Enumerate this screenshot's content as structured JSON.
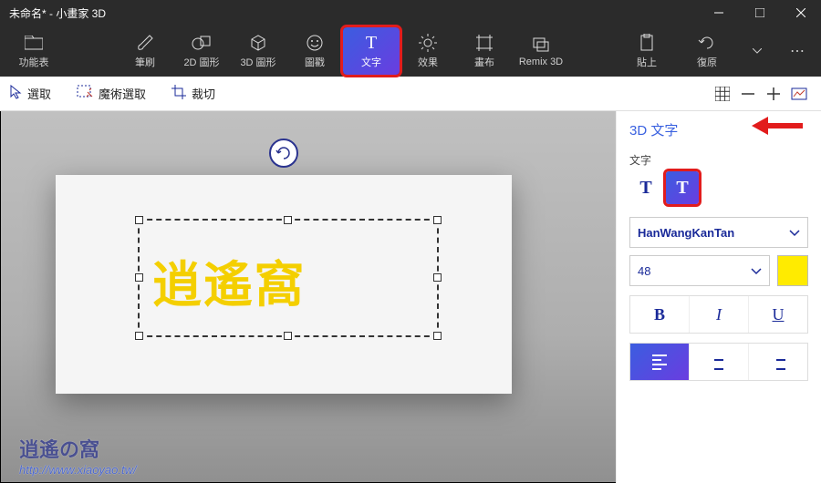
{
  "window": {
    "title": "未命名* - 小畫家 3D"
  },
  "ribbon": {
    "menu": "功能表",
    "brush": "筆刷",
    "shapes2d": "2D 圖形",
    "shapes3d": "3D 圖形",
    "stickers": "圖戳",
    "text": "文字",
    "effects": "效果",
    "canvas": "畫布",
    "remix": "Remix 3D",
    "paste": "貼上",
    "undo": "復原"
  },
  "subbar": {
    "select": "選取",
    "magic": "魔術選取",
    "crop": "裁切"
  },
  "panel": {
    "title": "3D 文字",
    "section_label": "文字",
    "font": "HanWangKanTan",
    "size": "48",
    "bold": "B",
    "italic": "I",
    "underline": "U",
    "color": "#ffeb00"
  },
  "canvas": {
    "text": "逍遙窩"
  },
  "watermark": {
    "brand": "逍遙の窩",
    "url": "http://www.xiaoyao.tw/"
  }
}
